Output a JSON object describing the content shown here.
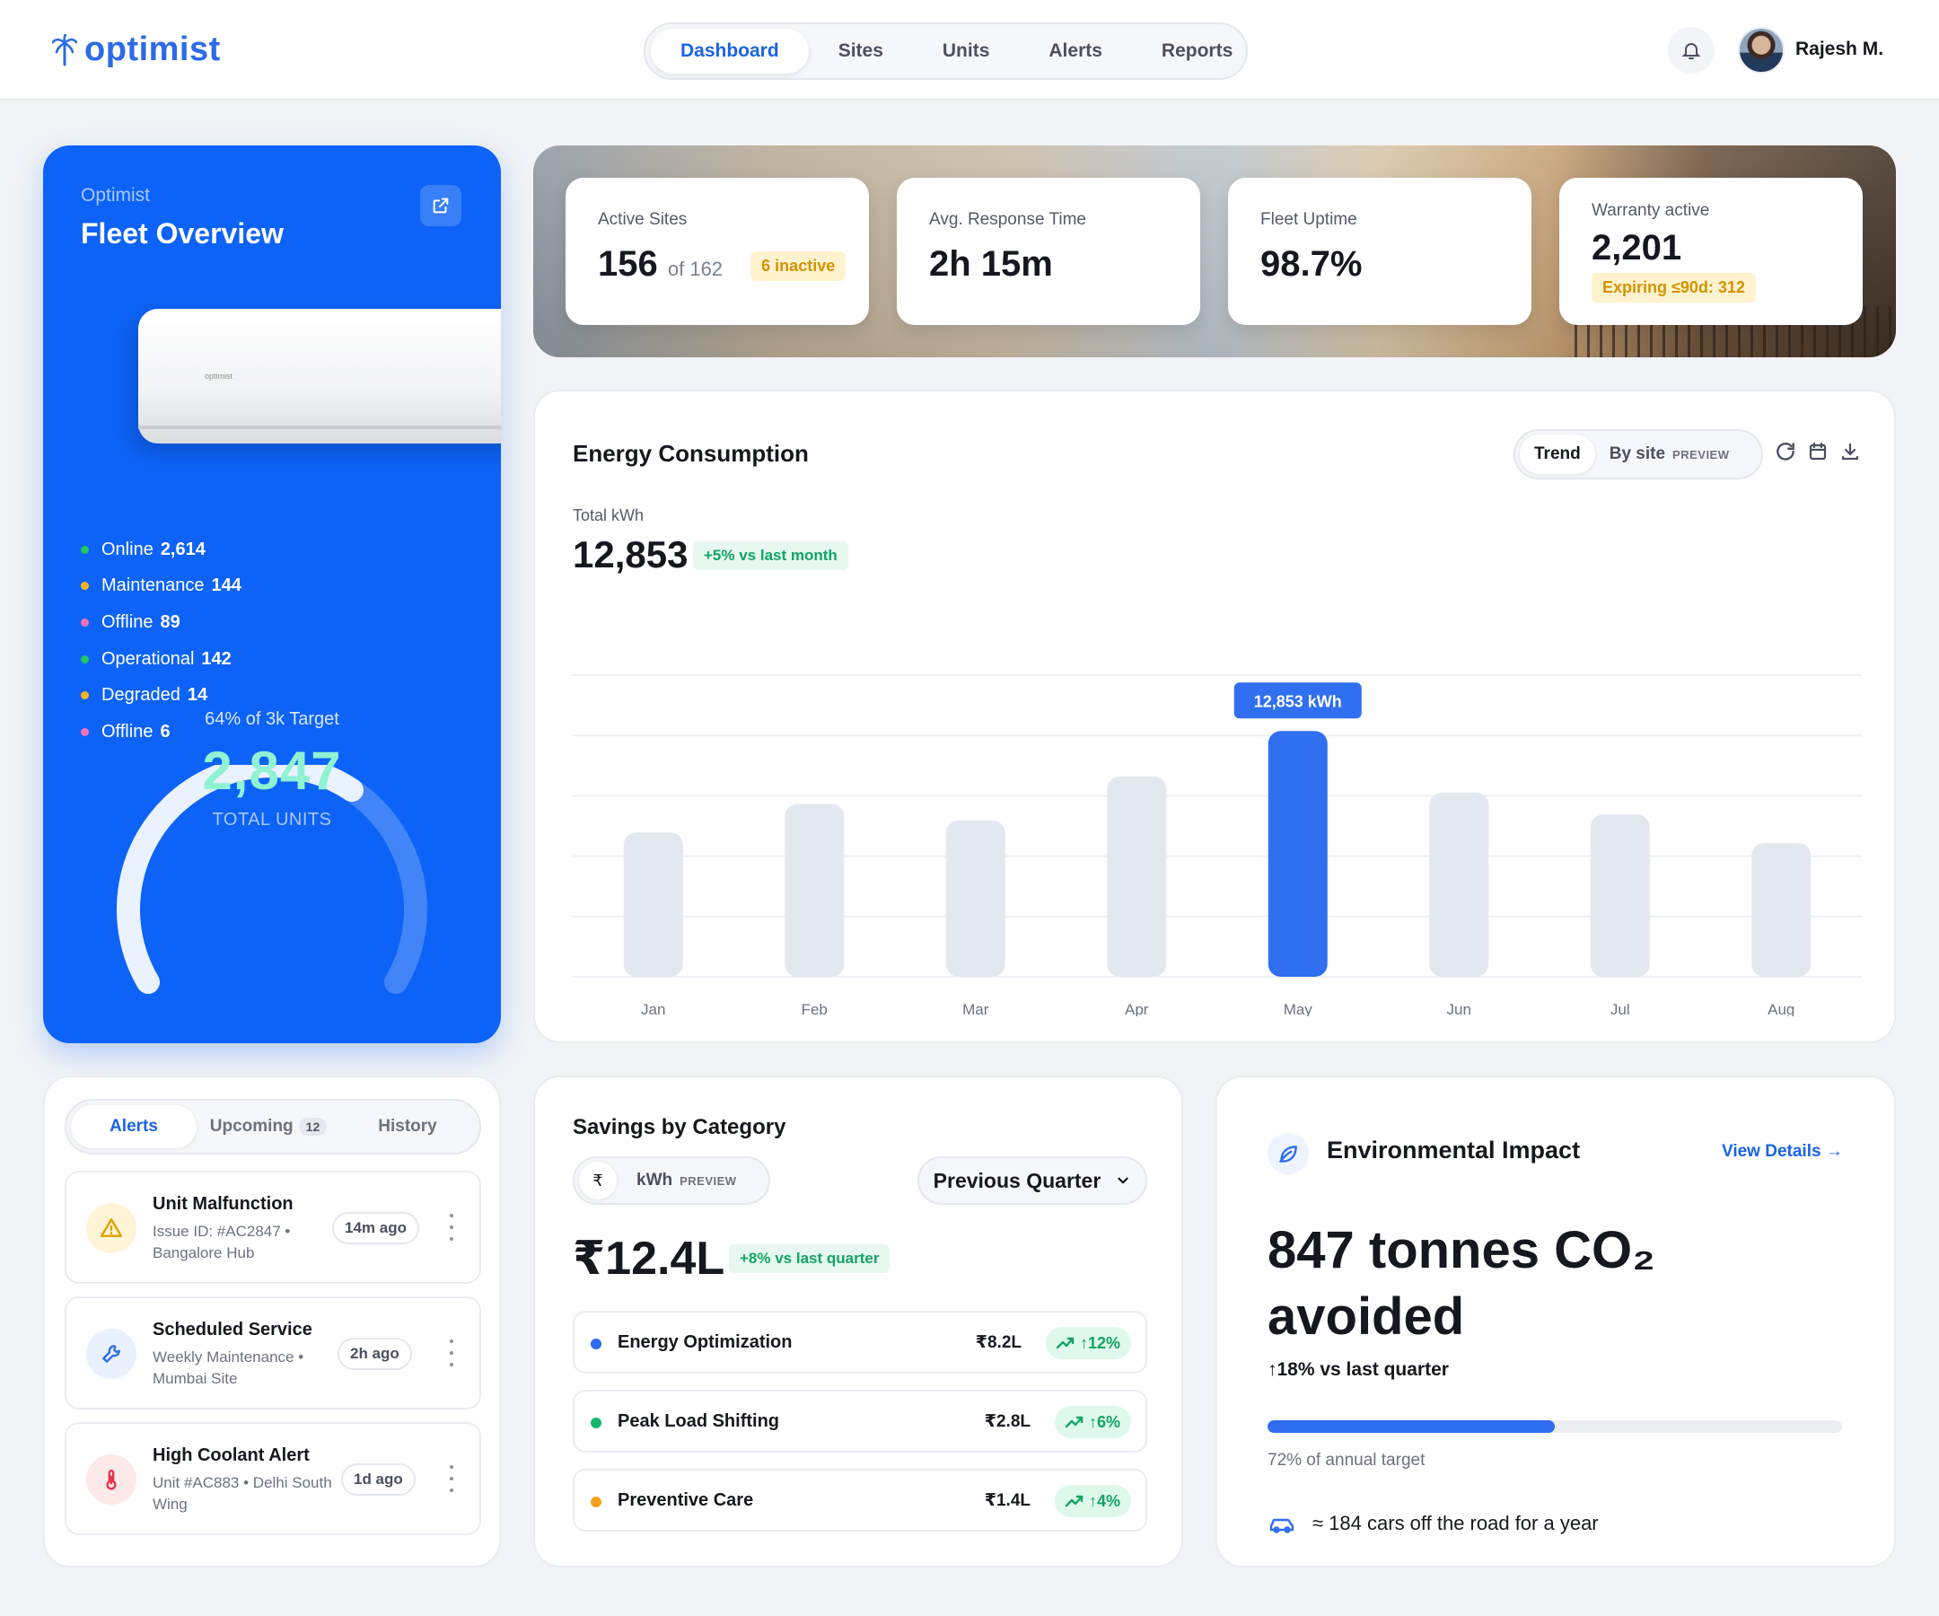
{
  "app": {
    "brand": "optimist",
    "user_name": "Rajesh M."
  },
  "nav": {
    "items": [
      {
        "label": "Dashboard",
        "active": true
      },
      {
        "label": "Sites",
        "active": false
      },
      {
        "label": "Units",
        "active": false
      },
      {
        "label": "Alerts",
        "active": false
      },
      {
        "label": "Reports",
        "active": false
      }
    ]
  },
  "fleet": {
    "kicker": "Optimist",
    "title": "Fleet Overview",
    "ac_brand": "optimist",
    "statuses": [
      {
        "label": "Online",
        "value": "2,614",
        "color": "#22c55e"
      },
      {
        "label": "Maintenance",
        "value": "144",
        "color": "#f6b51e"
      },
      {
        "label": "Offline",
        "value": "89",
        "color": "#f472b6"
      },
      {
        "label": "Operational",
        "value": "142",
        "color": "#22c55e"
      },
      {
        "label": "Degraded",
        "value": "14",
        "color": "#f6b51e"
      },
      {
        "label": "Offline",
        "value": "6",
        "color": "#f472b6"
      }
    ],
    "gauge": {
      "label": "64% of 3k Target",
      "value": "2,847",
      "sub": "TOTAL UNITS",
      "fraction": 0.64
    }
  },
  "stats": {
    "active_sites": {
      "label": "Active Sites",
      "value": "156",
      "of": "of 162",
      "badge": "6 inactive"
    },
    "response": {
      "label": "Avg. Response Time",
      "value": "2h 15m"
    },
    "uptime": {
      "label": "Fleet Uptime",
      "value": "98.7%"
    },
    "warranty": {
      "label": "Warranty active",
      "value": "2,201",
      "badge": "Expiring ≤90d: 312"
    }
  },
  "energy": {
    "title": "Energy Consumption",
    "seg_trend": "Trend",
    "seg_site": "By site",
    "seg_tag": "PREVIEW",
    "kpi_label": "Total kWh",
    "kpi_value": "12,853",
    "delta": "+5% vs last month"
  },
  "chart_data": {
    "type": "bar",
    "categories": [
      "Jan",
      "Feb",
      "Mar",
      "Apr",
      "May",
      "Jun",
      "Jul",
      "Aug"
    ],
    "values": [
      8130,
      9740,
      8810,
      11280,
      13850,
      10380,
      9150,
      7540
    ],
    "highlight_index": 4,
    "tooltip": "12,853 kWh",
    "ylim": [
      0,
      17000
    ],
    "grid": true,
    "colors": {
      "bar": "#e3e8f0",
      "highlight": "#2f6ff0"
    }
  },
  "alerts": {
    "tabs": [
      {
        "label": "Alerts",
        "active": true
      },
      {
        "label": "Upcoming",
        "count": "12"
      },
      {
        "label": "History"
      }
    ],
    "items": [
      {
        "title": "Unit Malfunction",
        "sub": "Issue ID: #AC2847 • Bangalore Hub",
        "time": "14m ago",
        "icon": "warning-icon",
        "bg": "#fff4d6",
        "fg": "#e0a100"
      },
      {
        "title": "Scheduled Service",
        "sub": "Weekly Maintenance • Mumbai Site",
        "time": "2h ago",
        "icon": "wrench-icon",
        "bg": "#eaf1fe",
        "fg": "#2f6df0"
      },
      {
        "title": "High Coolant Alert",
        "sub": "Unit #AC883 • Delhi South Wing",
        "time": "1d ago",
        "icon": "thermometer-icon",
        "bg": "#fde8ea",
        "fg": "#e0364a"
      }
    ]
  },
  "savings": {
    "title": "Savings by Category",
    "unit_symbol": "₹",
    "unit_label": "kWh",
    "unit_tag": "PREVIEW",
    "period": "Previous Quarter",
    "value": "₹12.4L",
    "delta": "+8% vs last quarter",
    "categories": [
      {
        "name": "Energy Optimization",
        "amount": "₹8.2L",
        "delta": "↑12%",
        "color": "#2f6df0"
      },
      {
        "name": "Peak Load Shifting",
        "amount": "₹2.8L",
        "delta": "↑6%",
        "color": "#12b76a"
      },
      {
        "name": "Preventive Care",
        "amount": "₹1.4L",
        "delta": "↑4%",
        "color": "#f6a21e"
      }
    ]
  },
  "env": {
    "title": "Environmental Impact",
    "link": "View Details →",
    "big_line1": "847 tonnes CO₂",
    "big_line2": "avoided",
    "delta": "↑18% vs last quarter",
    "progress_label": "72% of annual target",
    "progress": 0.5,
    "cars": "≈ 184 cars off the road for a year"
  }
}
